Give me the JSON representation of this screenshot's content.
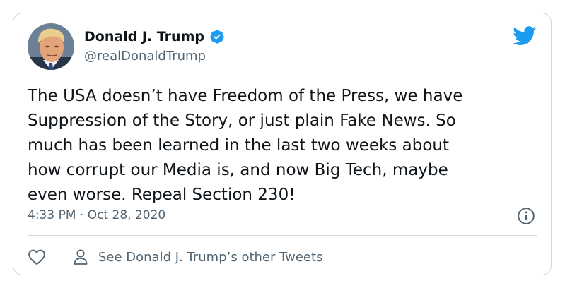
{
  "author": {
    "display_name": "Donald J. Trump",
    "handle": "@realDonaldTrump",
    "verified": true,
    "avatar_icon": "avatar-photo"
  },
  "tweet": {
    "text": "The USA doesn’t have Freedom of the Press, we have\nSuppression of the Story, or just plain Fake News. So\nmuch has been learned in the last two weeks about\nhow corrupt our Media is, and now Big Tech, maybe\neven worse. Repeal Section 230!",
    "timestamp": "4:33 PM · Oct 28, 2020"
  },
  "footer": {
    "like_icon": "heart-icon",
    "other_tweets_icon": "person-icon",
    "other_tweets_label": "See Donald J. Trump’s other Tweets"
  },
  "icons": {
    "brand": "twitter-bird-icon",
    "verified": "verified-badge-icon",
    "info": "info-icon"
  },
  "colors": {
    "brand": "#1d9bf0",
    "text_primary": "#0f1419",
    "text_secondary": "#536471",
    "border": "#cfd9de"
  }
}
